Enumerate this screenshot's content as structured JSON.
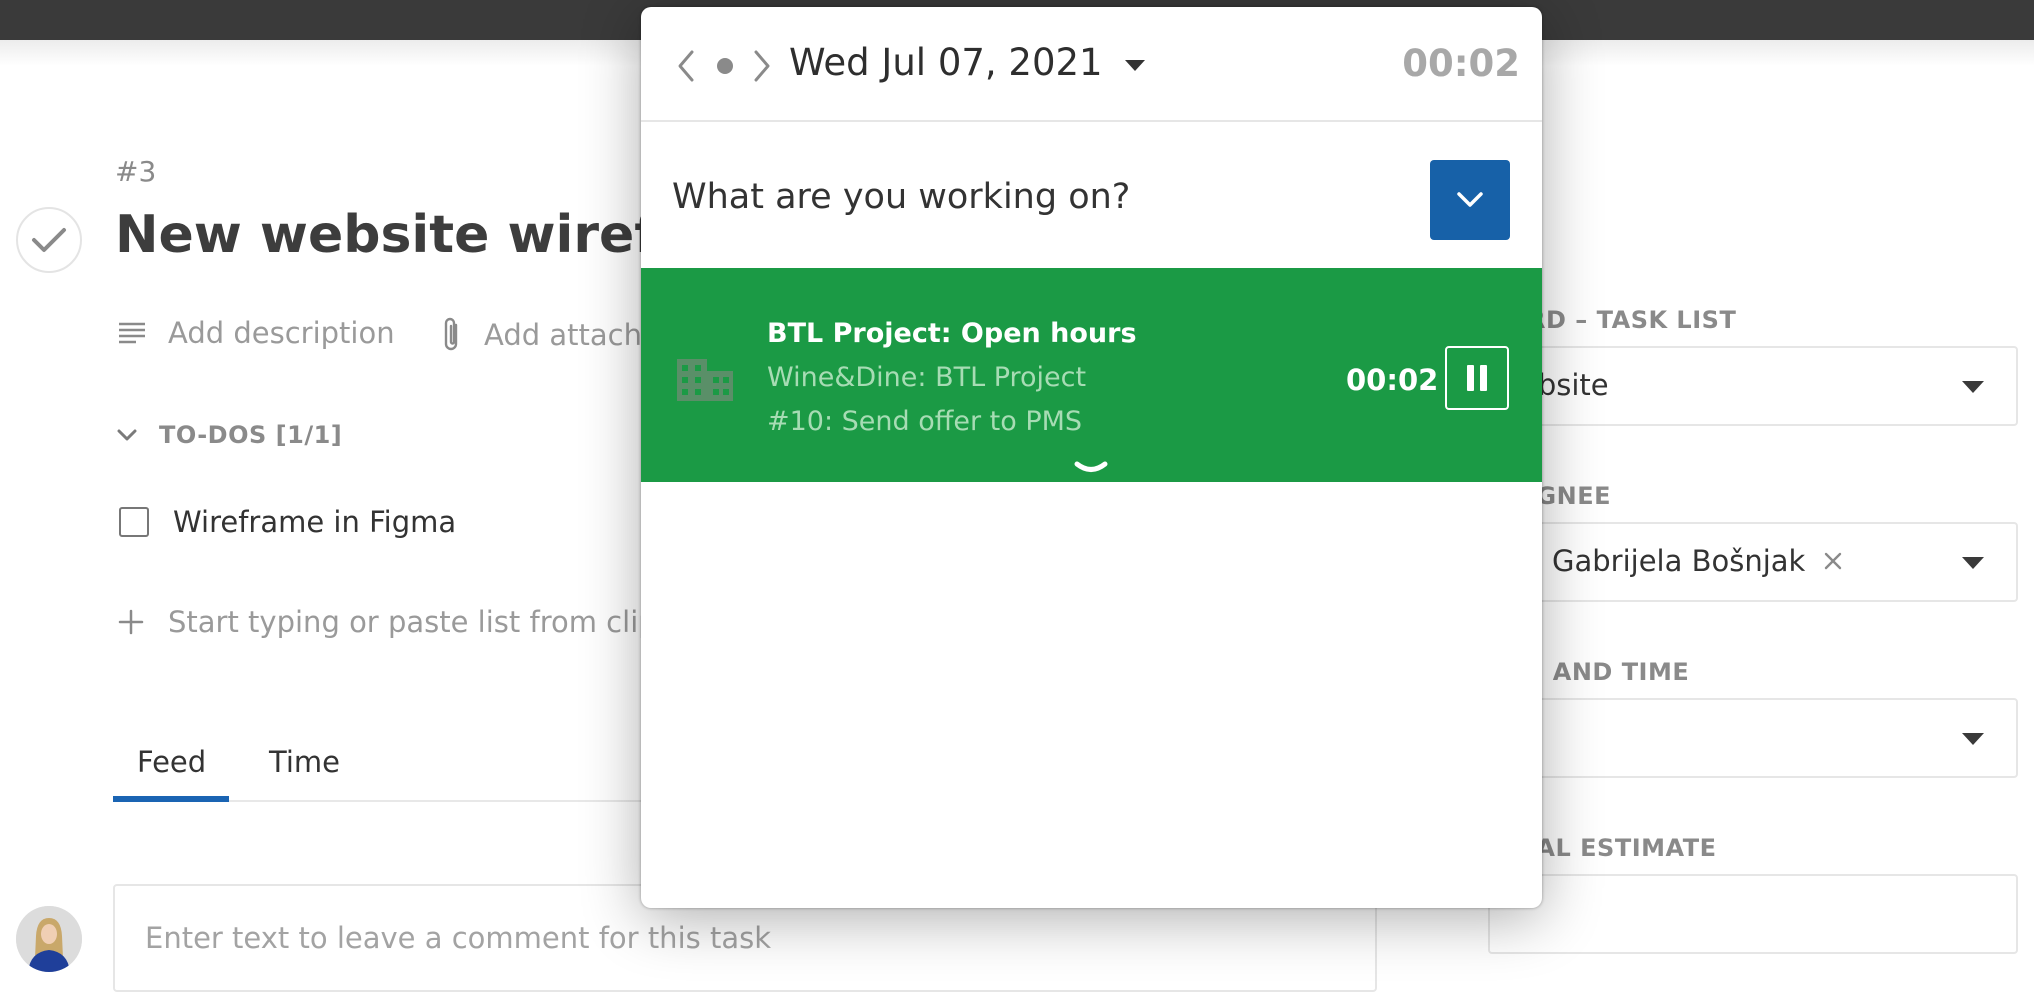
{
  "task": {
    "number": "#3",
    "title": "New website wirefram",
    "add_description": "Add description",
    "add_attachment": "Add attachm",
    "todos_header": "TO-DOS [1/1]",
    "todos": [
      {
        "label": "Wireframe in Figma",
        "checked": false
      }
    ],
    "add_todo_placeholder": "Start typing or paste list from clipb",
    "tabs": [
      {
        "label": "Feed",
        "active": true
      },
      {
        "label": "Time",
        "active": false
      }
    ],
    "comment_placeholder": "Enter text to leave a comment for this task"
  },
  "sidebar": {
    "board_label": "RD – TASK LIST",
    "board_value": "ebsite",
    "assignee_label": "IGNEE",
    "assignee_value": "Gabrijela Bošnjak",
    "date_label": "E AND TIME",
    "date_value": "",
    "estimate_label": "IAL ESTIMATE",
    "estimate_value": ""
  },
  "popup": {
    "date": "Wed Jul 07, 2021",
    "timer": "00:02",
    "prompt": "What are you working on?",
    "entry": {
      "title": "BTL Project: Open hours",
      "client_project": "Wine&Dine: BTL Project",
      "task": "#10: Send offer to PMS",
      "timer": "00:02"
    }
  },
  "colors": {
    "accent_blue": "#1761a8",
    "tab_underline": "#1a64b3",
    "entry_green": "#1b9a45",
    "topbar": "#3a3a3a"
  },
  "icons": [
    "check-icon",
    "description-icon",
    "paperclip-icon",
    "chevron-down-icon",
    "plus-icon",
    "chevron-left-icon",
    "dot-icon",
    "chevron-right-icon",
    "building-icon",
    "pause-icon",
    "close-icon"
  ]
}
